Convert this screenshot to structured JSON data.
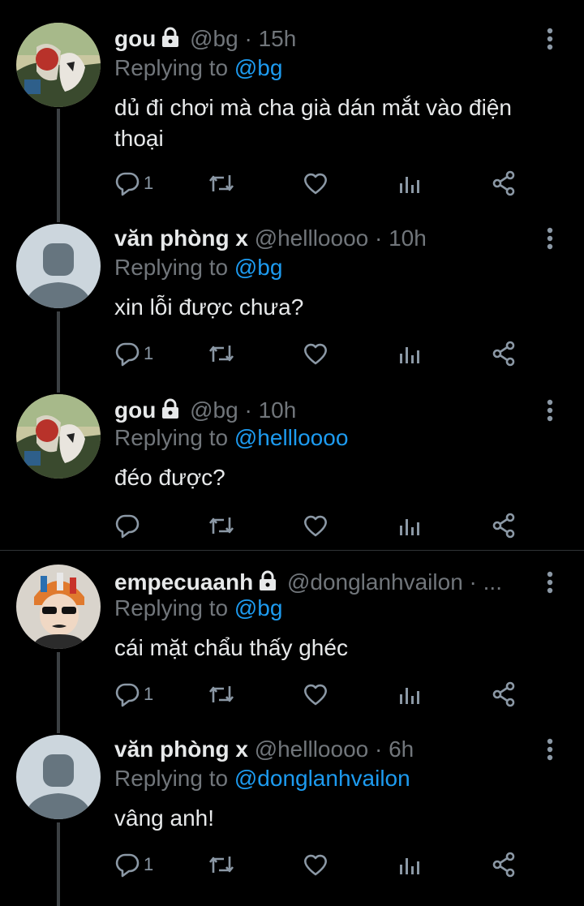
{
  "tweets": [
    {
      "name": "gou",
      "locked": true,
      "handle": "@bg",
      "sep": "·",
      "time": "15h",
      "replying_prefix": "Replying to",
      "replying_to": "@bg",
      "text": "dủ đi chơi mà cha già dán mắt vào điện thoại",
      "reply_count": "1",
      "avatar": "anime-illustration-avatar"
    },
    {
      "name": "văn phòng x",
      "locked": false,
      "handle": "@hellloooo",
      "sep": "·",
      "time": "10h",
      "replying_prefix": "Replying to",
      "replying_to": "@bg",
      "text": "xin lỗi được chưa?",
      "reply_count": "1",
      "avatar": "default-avatar"
    },
    {
      "name": "gou",
      "locked": true,
      "handle": "@bg",
      "sep": "·",
      "time": "10h",
      "replying_prefix": "Replying to",
      "replying_to": "@hellloooo",
      "text": "đéo được?",
      "reply_count": "",
      "avatar": "anime-illustration-avatar"
    },
    {
      "name": "empecuaanh",
      "locked": true,
      "handle": "@donglanhvailon",
      "sep": "·",
      "time": "...",
      "replying_prefix": "Replying to",
      "replying_to": "@bg",
      "text": "cái mặt chẩu thấy ghéc",
      "reply_count": "1",
      "avatar": "person-photo-avatar"
    },
    {
      "name": "văn phòng x",
      "locked": false,
      "handle": "@hellloooo",
      "sep": "·",
      "time": "6h",
      "replying_prefix": "Replying to",
      "replying_to": "@donglanhvailon",
      "text": "vâng anh!",
      "reply_count": "1",
      "avatar": "default-avatar"
    }
  ],
  "icons": {
    "more": "more-vertical-icon",
    "reply": "reply-icon",
    "retweet": "retweet-icon",
    "like": "heart-icon",
    "views": "analytics-icon",
    "share": "share-icon",
    "lock": "lock-icon"
  },
  "colors": {
    "background": "#000000",
    "text": "#e7e9ea",
    "muted": "#71767b",
    "link": "#1d9bf0",
    "thread_line": "#3c4043"
  }
}
